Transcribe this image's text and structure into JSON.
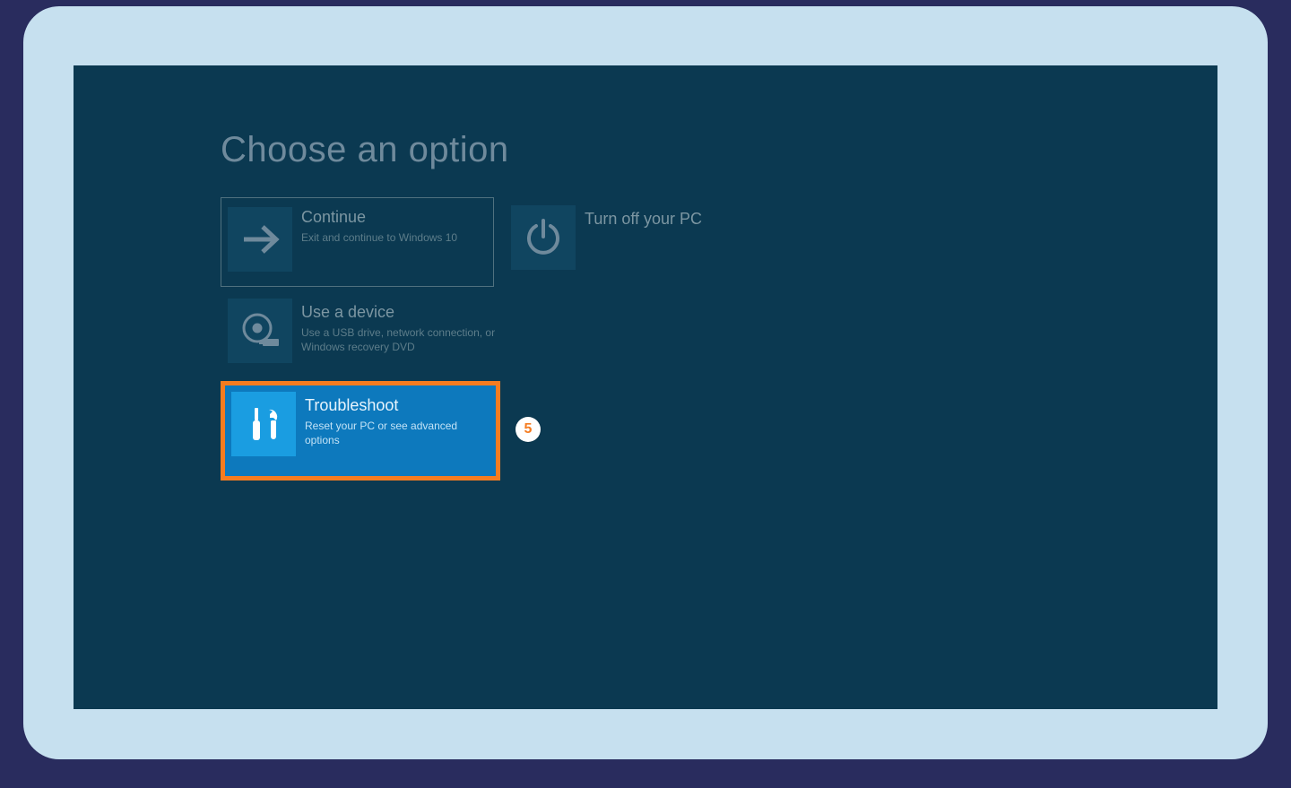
{
  "title": "Choose an option",
  "options": {
    "continue": {
      "title": "Continue",
      "desc": "Exit and continue to Windows 10"
    },
    "turnoff": {
      "title": "Turn off your PC",
      "desc": ""
    },
    "use_device": {
      "title": "Use a device",
      "desc": "Use a USB drive, network connection, or Windows recovery DVD"
    },
    "troubleshoot": {
      "title": "Troubleshoot",
      "desc": "Reset your PC or see advanced options"
    }
  },
  "badge": {
    "step": "5"
  },
  "colors": {
    "page_bg": "#292c5e",
    "panel_bg": "#c6e0ef",
    "screen_bg": "#0b3951",
    "dim_text": "#6f8a9c",
    "dim_icon_bg": "#104560",
    "highlight_bg": "#0d79bd",
    "highlight_icon_bg": "#1a9de1",
    "highlight_border": "#f57c20",
    "badge_bg": "#ffffff",
    "badge_text": "#f57c20"
  }
}
